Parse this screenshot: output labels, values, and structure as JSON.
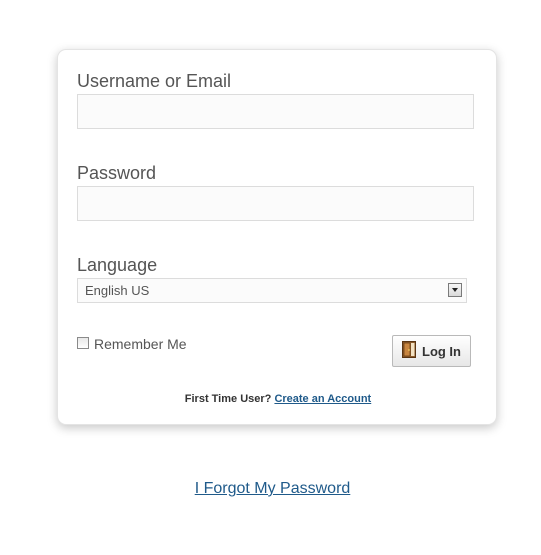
{
  "login_form": {
    "username": {
      "label": "Username or Email",
      "value": "",
      "placeholder": ""
    },
    "password": {
      "label": "Password",
      "value": "",
      "placeholder": ""
    },
    "language": {
      "label": "Language",
      "selected": "English US"
    },
    "remember_me": {
      "label": "Remember Me",
      "checked": false
    },
    "login_button": {
      "label": "Log In",
      "icon": "door-icon"
    },
    "first_time": {
      "prompt": "First Time User?",
      "link_label": "Create an Account"
    }
  },
  "forgot_password": {
    "link_label": "I Forgot My Password"
  },
  "colors": {
    "link": "#1f5a8a",
    "label": "#555555",
    "input_border": "#dcdcdc",
    "input_background": "#fbfbfb"
  }
}
